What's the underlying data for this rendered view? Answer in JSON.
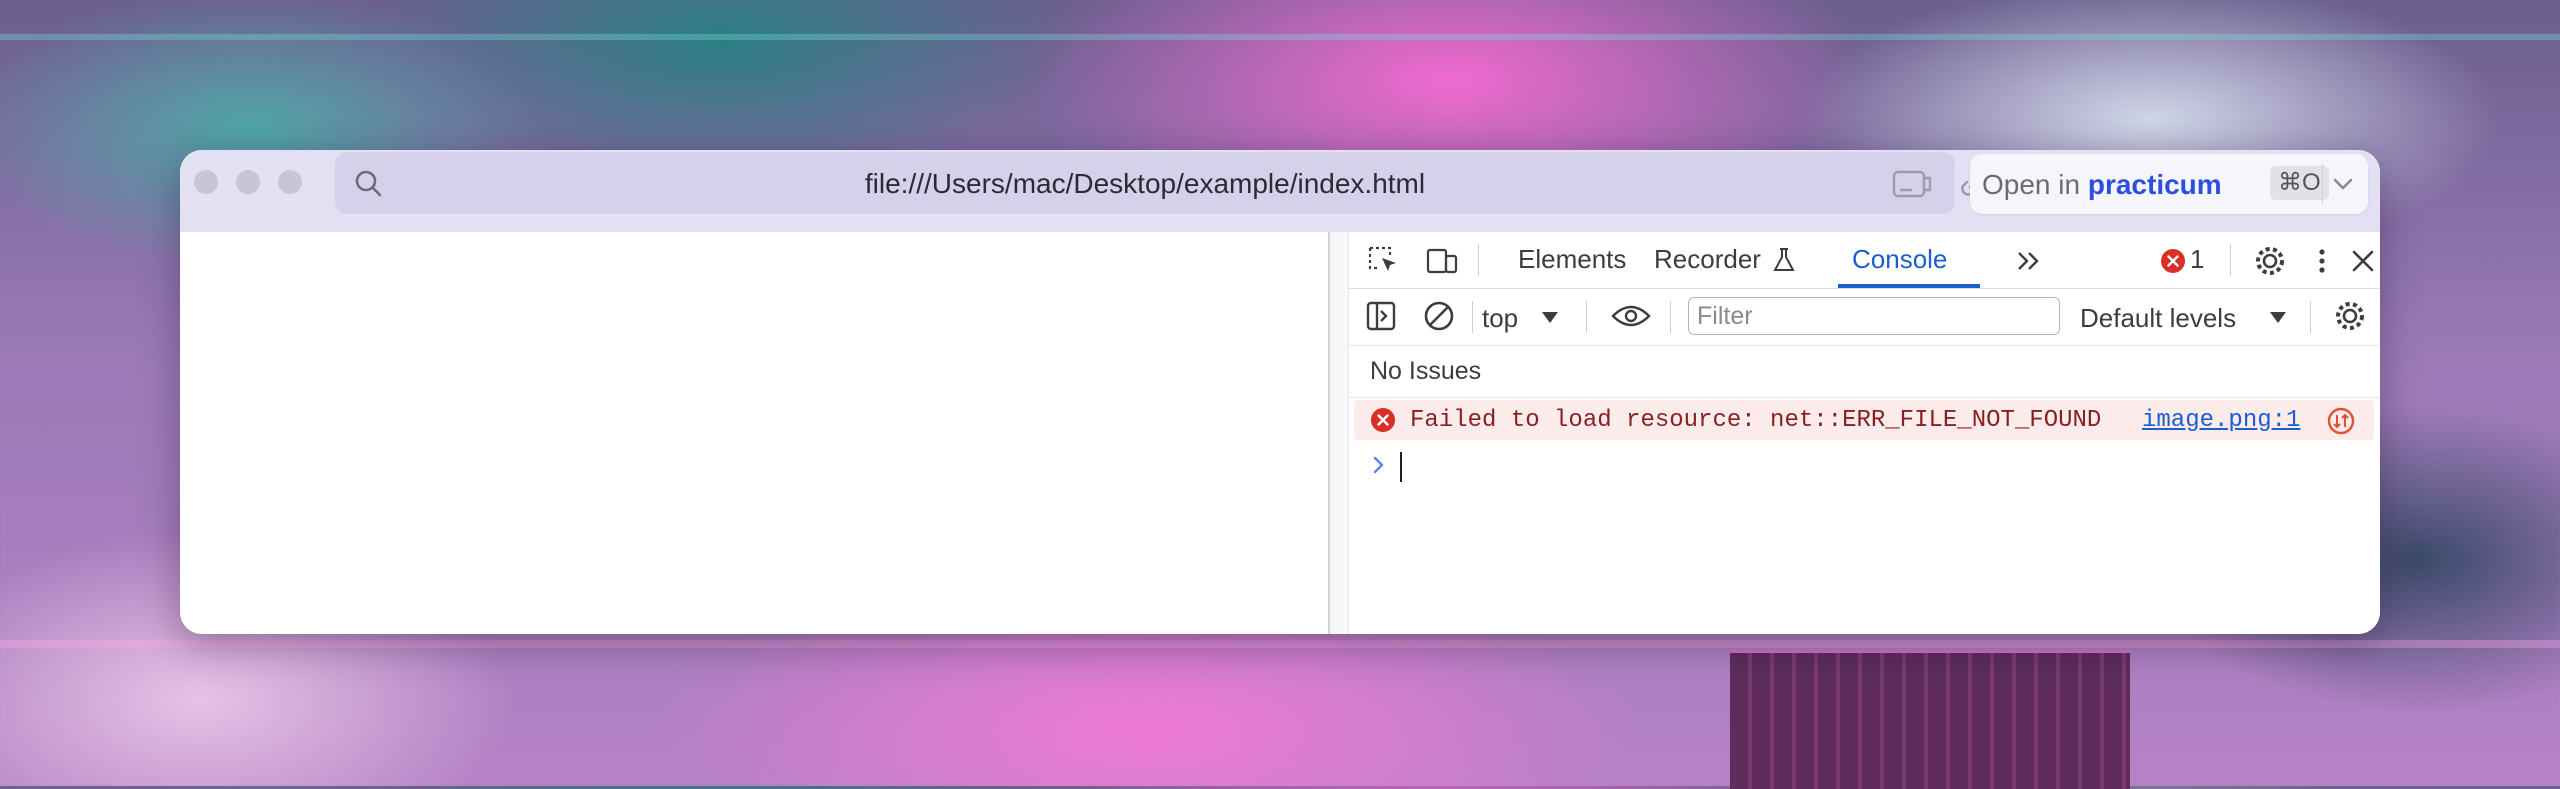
{
  "browser": {
    "url": "file:///Users/mac/Desktop/example/index.html",
    "open_in": {
      "prefix": "Open in",
      "brand": "practicum",
      "shortcut": "⌘O"
    }
  },
  "devtools": {
    "tabs": [
      "Elements",
      "Recorder",
      "Console"
    ],
    "active_tab": "Console",
    "error_count": "1",
    "console_toolbar": {
      "context": "top",
      "filter_placeholder": "Filter",
      "levels": "Default levels"
    },
    "issues_text": "No Issues",
    "messages": [
      {
        "type": "error",
        "text": "Failed to load resource: net::ERR_FILE_NOT_FOUND",
        "source": "image.png:1"
      }
    ]
  },
  "colors": {
    "accent_blue": "#1a5fd0",
    "error_red": "#d93025",
    "brand": "#2b4fe0"
  }
}
